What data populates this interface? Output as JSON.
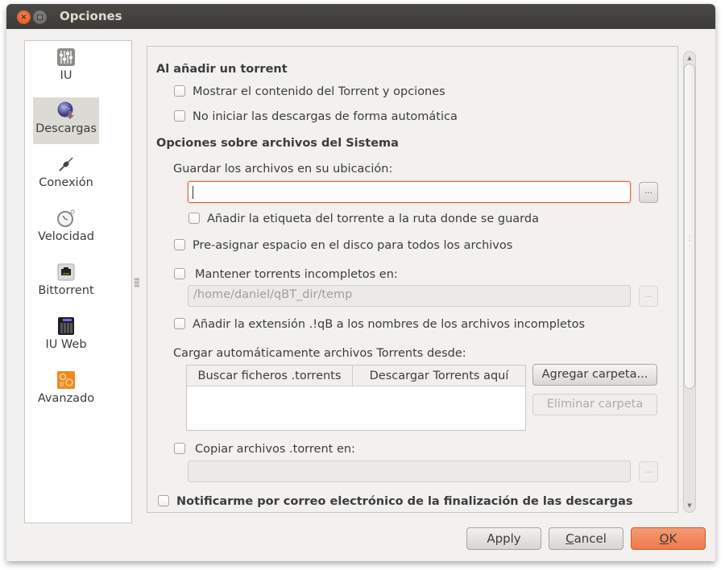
{
  "window": {
    "title": "Opciones",
    "close_icon": "close-icon",
    "maximize_icon": "maximize-icon"
  },
  "sidebar": {
    "items": [
      {
        "label": "IU",
        "icon": "equalizer-icon",
        "selected": false
      },
      {
        "label": "Descargas",
        "icon": "globe-download-icon",
        "selected": true
      },
      {
        "label": "Conexión",
        "icon": "plug-icon",
        "selected": false
      },
      {
        "label": "Velocidad",
        "icon": "stopwatch-icon",
        "selected": false
      },
      {
        "label": "Bittorrent",
        "icon": "network-port-icon",
        "selected": false
      },
      {
        "label": "IU Web",
        "icon": "server-icon",
        "selected": false
      },
      {
        "label": "Avanzado",
        "icon": "advanced-gears-icon",
        "selected": false
      }
    ]
  },
  "content": {
    "section_add_torrent": {
      "heading": "Al añadir un torrent",
      "show_content": {
        "label": "Mostrar el contenido del Torrent y opciones",
        "checked": false
      },
      "dont_start": {
        "label": "No iniciar las descargas de forma automática",
        "checked": false
      }
    },
    "section_filesystem": {
      "heading": "Opciones sobre archivos del Sistema",
      "save_location_label": "Guardar los archivos en su ubicación:",
      "save_location_value": "",
      "browse_label": "...",
      "append_label": {
        "label": "Añadir la etiqueta del torrente a la ruta donde se guarda",
        "checked": false
      },
      "preallocate": {
        "label": "Pre-asignar espacio en el disco para todos los archivos",
        "checked": false
      },
      "keep_incomplete": {
        "label": "Mantener torrents incompletos en:",
        "checked": false
      },
      "incomplete_path": "/home/daniel/qBT_dir/temp",
      "append_qb_ext": {
        "label": "Añadir la extensión .!qB a los nombres de los archivos incompletos",
        "checked": false
      },
      "autoload_label": "Cargar automáticamente archivos Torrents desde:",
      "autoload_table": {
        "columns": [
          "Buscar ficheros .torrents",
          "Descargar Torrents aquí"
        ],
        "rows": []
      },
      "add_folder_label": "Agregar carpeta...",
      "remove_folder_label": "Eliminar carpeta",
      "copy_torrent": {
        "label": "Copiar archivos .torrent en:",
        "checked": false
      },
      "copy_torrent_path": ""
    },
    "notify_email": {
      "label": "Notificarme por correo electrónico de la finalización de las descargas",
      "checked": false
    }
  },
  "scrollbar": {
    "position_fraction": 0.0,
    "visible_fraction": 0.72
  },
  "buttons": {
    "apply": "Apply",
    "cancel_mnemonic": "C",
    "cancel_rest": "ancel",
    "ok_mnemonic": "O",
    "ok_rest": "K"
  },
  "colors": {
    "accent": "#ef7a4c",
    "titlebar": "#3c3b37",
    "focus_border": "#e0632f"
  }
}
